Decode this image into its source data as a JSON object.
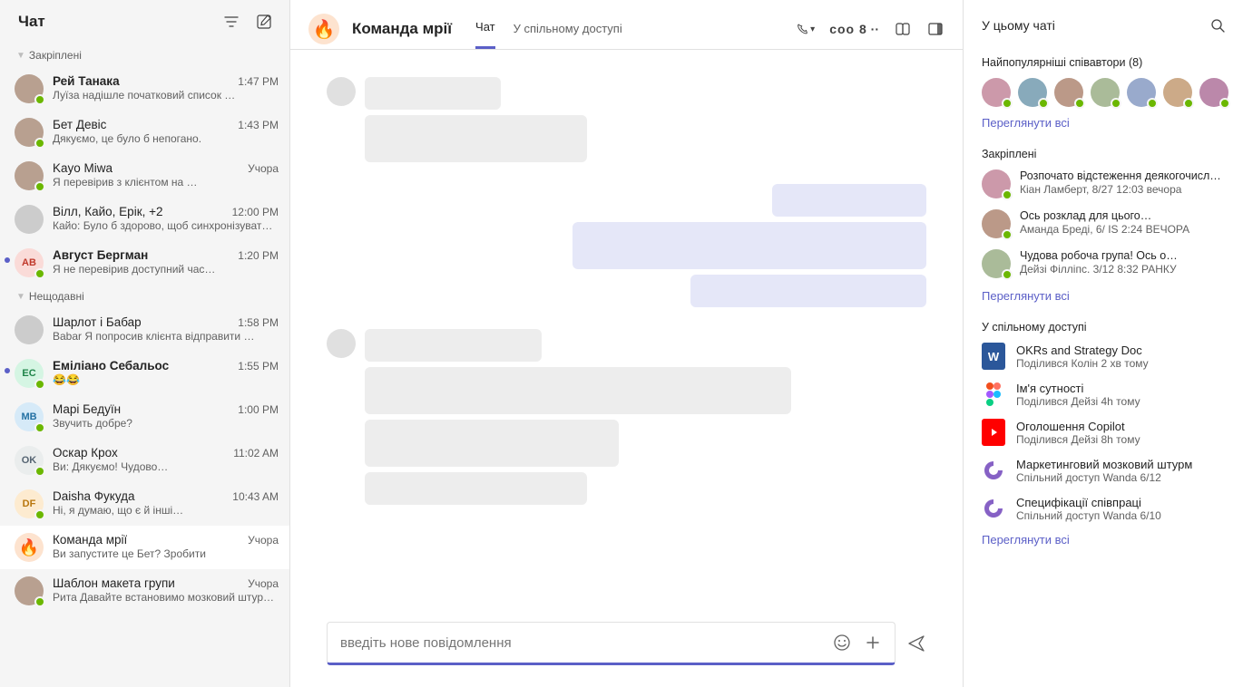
{
  "sidebar": {
    "title": "Чат",
    "sections": {
      "pinned": "Закріплені",
      "recent": "Нещодавні"
    },
    "pinned": [
      {
        "name": "Рей Танака",
        "preview": "Луїза надішле початковий список …",
        "time": "1:47 PM",
        "bold": true,
        "dot": false,
        "avatar": "img",
        "presence": "avail"
      },
      {
        "name": "Бет   Девіс",
        "preview": "Дякуємо, це було б непогано.",
        "time": "1:43 PM",
        "bold": false,
        "dot": false,
        "avatar": "img",
        "presence": "avail"
      },
      {
        "name": "Kayo Miwa",
        "preview": "Я перевірив з клієнтом на …",
        "time": "Учора",
        "bold": false,
        "dot": false,
        "avatar": "img",
        "presence": "avail"
      },
      {
        "name": "Вілл, Кайо, Ерік, +2",
        "preview": "Кайо: Було б здорово, щоб синхронізувати …",
        "time": "12:00 PM",
        "bold": false,
        "dot": false,
        "avatar": "grp",
        "presence": ""
      },
      {
        "name": "Август Бергман",
        "preview": "Я не перевірив доступний час…",
        "time": "1:20 PM",
        "bold": true,
        "dot": true,
        "avatar": "AB",
        "avbg": "#fadbd8",
        "avfg": "#c0392b",
        "presence": "avail"
      }
    ],
    "recent": [
      {
        "name": "Шарлот і      Бабар",
        "preview": "Babar Я попросив клієнта відправити …",
        "time": "1:58 PM",
        "bold": false,
        "avatar": "grp",
        "presence": ""
      },
      {
        "name": "Еміліано Себальос",
        "preview": "😂😂",
        "time": "1:55 PM",
        "bold": true,
        "dot": true,
        "avatar": "EC",
        "avbg": "#d5f5e3",
        "avfg": "#1e8449",
        "presence": "avail"
      },
      {
        "name": "Марі Бедуїн",
        "preview": "Звучить добре?",
        "time": "1:00 PM",
        "bold": false,
        "avatar": "MB",
        "avbg": "#d6eaf8",
        "avfg": "#2471a3",
        "presence": "avail"
      },
      {
        "name": "Оскар Крох",
        "preview": "Ви: Дякуємо! Чудово…",
        "time": "11:02 AM",
        "bold": false,
        "avatar": "OK",
        "avbg": "#eaeded",
        "avfg": "#566573",
        "presence": "avail"
      },
      {
        "name": "Daisha Фукуда",
        "preview": "Ні, я думаю, що є й інші…",
        "time": "10:43 AM",
        "bold": false,
        "avatar": "DF",
        "avbg": "#fdebd0",
        "avfg": "#b9770e",
        "presence": "avail"
      },
      {
        "name": "Команда мрії",
        "preview": "Ви запустите це Бет? Зробити",
        "time": "Учора",
        "bold": false,
        "avatar": "flame",
        "presence": "",
        "active": true
      },
      {
        "name": "Шаблон макета групи",
        "preview": "Рита Давайте встановимо мозковий штурм…",
        "time": "Учора",
        "bold": false,
        "avatar": "img",
        "presence": "avail"
      }
    ]
  },
  "header": {
    "title": "Команда мрії",
    "tabs": [
      "Чат",
      "У спільному доступі"
    ],
    "activeTab": 0,
    "members": "соо 8"
  },
  "compose": {
    "placeholder": "введіть нове повідомлення"
  },
  "rightpanel": {
    "title": "У цьому чаті",
    "coauthors": "Найпопулярніші співавтори (8)",
    "viewAll": "Переглянути всі",
    "pinnedLabel": "Закріплені",
    "pinned": [
      {
        "title": "Розпочато відстеження деякогочисла…",
        "sub": "Кіан Ламберт, 8/27 12:03 вечора"
      },
      {
        "title": "Ось розклад для цього…",
        "sub": "Аманда  Бреді, 6/ IS 2:24 ВЕЧОРА"
      },
      {
        "title": "Чудова робоча група!  Ось о…",
        "sub": "Дейзі Філліпс. 3/12 8:32 РАНКУ"
      }
    ],
    "sharedLabel": "У спільному доступі",
    "shared": [
      {
        "icon": "word",
        "title": "OKRs and Strategy Doc",
        "sub": "Поділився Колін 2 хв тому"
      },
      {
        "icon": "figma",
        "title": "Ім'я сутності",
        "sub": "Поділився Дейзі 4h тому"
      },
      {
        "icon": "yt",
        "title": "Оголошення Copilot",
        "sub": "Поділився Дейзі 8h тому"
      },
      {
        "icon": "loop",
        "title": "Маркетинговий мозковий штурм",
        "sub": "Спільний доступ Wanda 6/12"
      },
      {
        "icon": "loop",
        "title": "Специфікації співпраці",
        "sub": "Спільний доступ Wanda 6/10"
      }
    ]
  }
}
